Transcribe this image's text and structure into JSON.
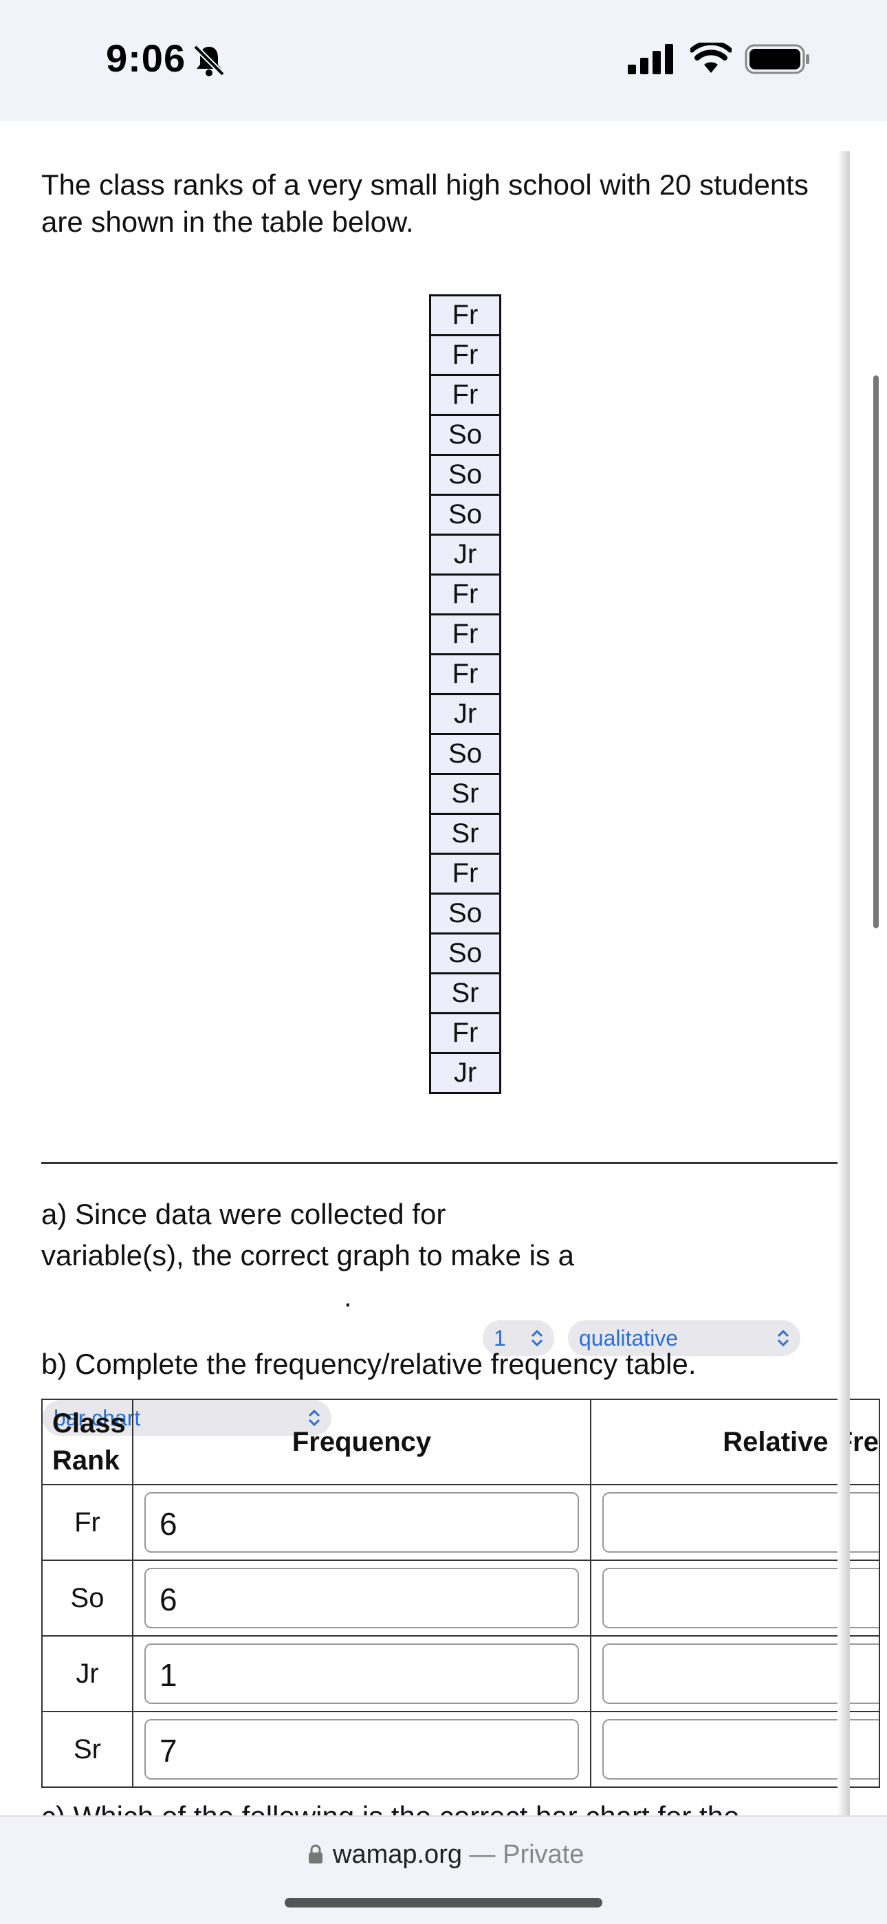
{
  "status_bar": {
    "time": "9:06"
  },
  "intro_text": "The class ranks of a very small high school with 20 students are shown in the table below.",
  "ranks": [
    "Fr",
    "Fr",
    "Fr",
    "So",
    "So",
    "So",
    "Jr",
    "Fr",
    "Fr",
    "Fr",
    "Jr",
    "So",
    "Sr",
    "Sr",
    "Fr",
    "So",
    "So",
    "Sr",
    "Fr",
    "Jr"
  ],
  "part_a": {
    "text1": "a) Since data were collected for",
    "count_select": "1",
    "type_select": "qualitative",
    "text2": "variable(s), the correct graph to make is a",
    "graph_select": "bar chart",
    "period": "."
  },
  "part_b": {
    "prompt": "b) Complete the frequency/relative frequency table.",
    "headers": {
      "class_rank": "Class Rank",
      "frequency": "Frequency",
      "relative": "Relative Fre"
    },
    "rows": [
      {
        "rank": "Fr",
        "frequency": "6",
        "relative": ""
      },
      {
        "rank": "So",
        "frequency": "6",
        "relative": ""
      },
      {
        "rank": "Jr",
        "frequency": "1",
        "relative": ""
      },
      {
        "rank": "Sr",
        "frequency": "7",
        "relative": ""
      }
    ]
  },
  "part_c_cut": "c) Which of the following is the correct bar chart for the",
  "browser": {
    "domain": "wamap.org",
    "separator": "—",
    "private": "Private"
  },
  "colors": {
    "accent": "#2a6fd6",
    "cell_bg": "#eeeefb"
  }
}
